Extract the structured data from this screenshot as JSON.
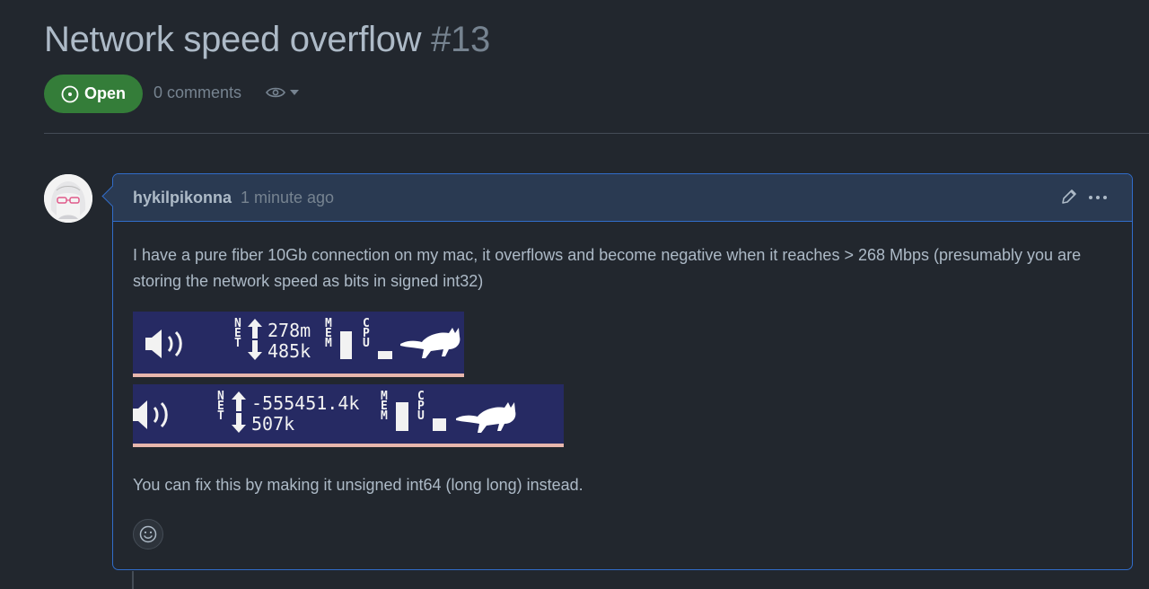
{
  "issue": {
    "title": "Network speed overflow",
    "number": "#13",
    "state": "Open",
    "comments": "0 comments"
  },
  "comment": {
    "author": "hykilpikonna",
    "time": "1 minute ago",
    "body": "I have a pure fiber 10Gb connection on my mac, it overflows and become negative when it reaches > 268 Mbps (presumably you are storing the network speed as bits in signed int32)",
    "footer": "You can fix this by making it unsigned int64 (long long) instead.",
    "screenshots": [
      {
        "net_label": "NET",
        "up": "278m",
        "down": "485k",
        "mem_label": "MEM",
        "cpu_label": "CPU"
      },
      {
        "net_label": "NET",
        "up": "-555451.4k",
        "down": "507k",
        "mem_label": "MEM",
        "cpu_label": "CPU"
      }
    ]
  },
  "colors": {
    "background": "#22272e",
    "open_badge": "#347d39",
    "comment_border": "#316dca",
    "comment_header": "#2a3a52",
    "screenshot_bg": "#262a63"
  },
  "icons": [
    "issue-open-icon",
    "eye-icon",
    "chevron-down-icon",
    "pencil-icon",
    "kebab-icon",
    "smiley-icon",
    "speaker-icon",
    "up-arrow-icon",
    "down-arrow-icon",
    "cat-icon"
  ]
}
